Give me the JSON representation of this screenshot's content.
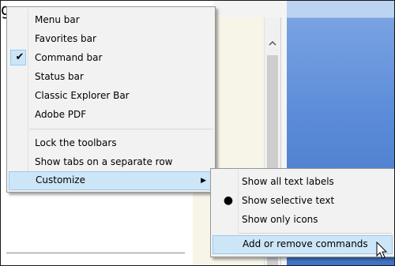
{
  "background": {
    "title_text": "g",
    "scroll_up_icon": "chevron-up"
  },
  "main_menu": {
    "items": [
      {
        "label": "Menu bar",
        "checked": false
      },
      {
        "label": "Favorites bar",
        "checked": false
      },
      {
        "label": "Command bar",
        "checked": true,
        "check_glyph": "✔"
      },
      {
        "label": "Status bar",
        "checked": false
      },
      {
        "label": "Classic Explorer Bar",
        "checked": false
      },
      {
        "label": "Adobe PDF",
        "checked": false
      },
      {
        "label": "Lock the toolbars",
        "checked": false
      },
      {
        "label": "Show tabs on a separate row",
        "checked": false
      },
      {
        "label": "Customize",
        "submenu": true,
        "arrow_glyph": "▶",
        "highlighted": true
      }
    ]
  },
  "customize_submenu": {
    "items": [
      {
        "label": "Show all text labels",
        "selected": false
      },
      {
        "label": "Show selective text",
        "selected": true,
        "radio_glyph": "●"
      },
      {
        "label": "Show only icons",
        "selected": false
      },
      {
        "label": "Add or remove commands",
        "highlighted": true
      }
    ]
  },
  "colors": {
    "menu_background": "#f2f2f2",
    "highlight": "#cde6f7",
    "highlight_border": "#99c9ef",
    "blue_pane": "#5a8bd8"
  }
}
